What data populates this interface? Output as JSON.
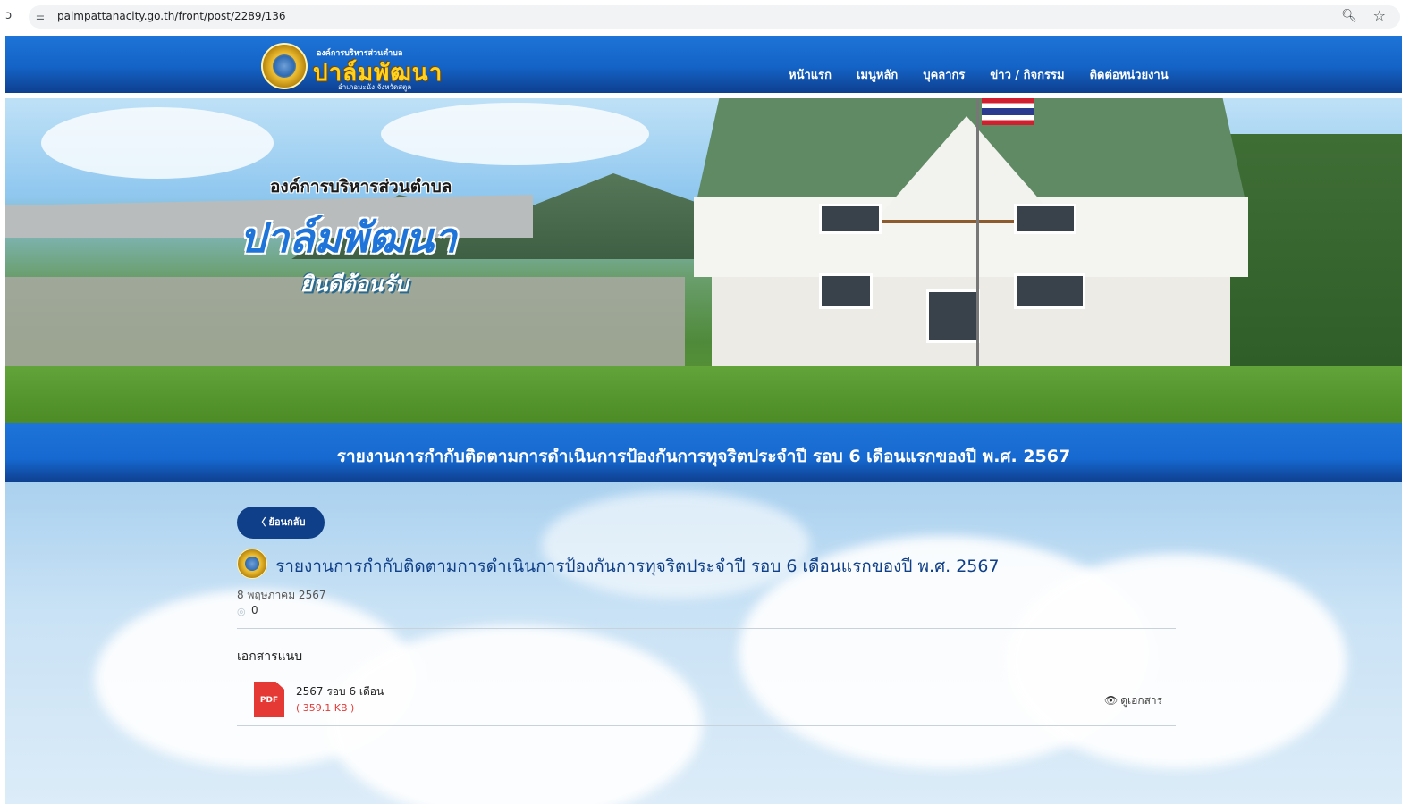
{
  "browser": {
    "url": "palmpattanacity.go.th/front/post/2289/136"
  },
  "header": {
    "logo_small": "องค์การบริหารส่วนตำบล",
    "logo_big": "ปาล์มพัฒนา",
    "logo_sub": "อำเภอมะนัง จังหวัดสตูล",
    "nav": [
      "หน้าแรก",
      "เมนูหลัก",
      "บุคลากร",
      "ข่าว / กิจกรรม",
      "ติดต่อหน่วยงาน"
    ]
  },
  "banner": {
    "small_title": "องค์การบริหารส่วนตำบล",
    "big_title": "ปาล์มพัฒนา",
    "welcome": "ยินดีต้อนรับ"
  },
  "title_bar": {
    "title": "รายงานการกำกับติดตามการดำเนินการป้องกันการทุจริตประจำปี รอบ 6 เดือนแรกของปี พ.ศ. 2567"
  },
  "post": {
    "back_label": "〈 ย้อนกลับ",
    "title": "รายงานการกำกับติดตามการดำเนินการป้องกันการทุจริตประจำปี รอบ 6 เดือนแรกของปี พ.ศ. 2567",
    "date": "8 พฤษภาคม 2567",
    "views": "0"
  },
  "attachments": {
    "label": "เอกสารแนบ",
    "items": [
      {
        "icon_text": "PDF",
        "name": "2567 รอบ 6 เดือน",
        "size": "( 359.1 KB )",
        "view_label": "ดูเอกสาร"
      }
    ]
  }
}
